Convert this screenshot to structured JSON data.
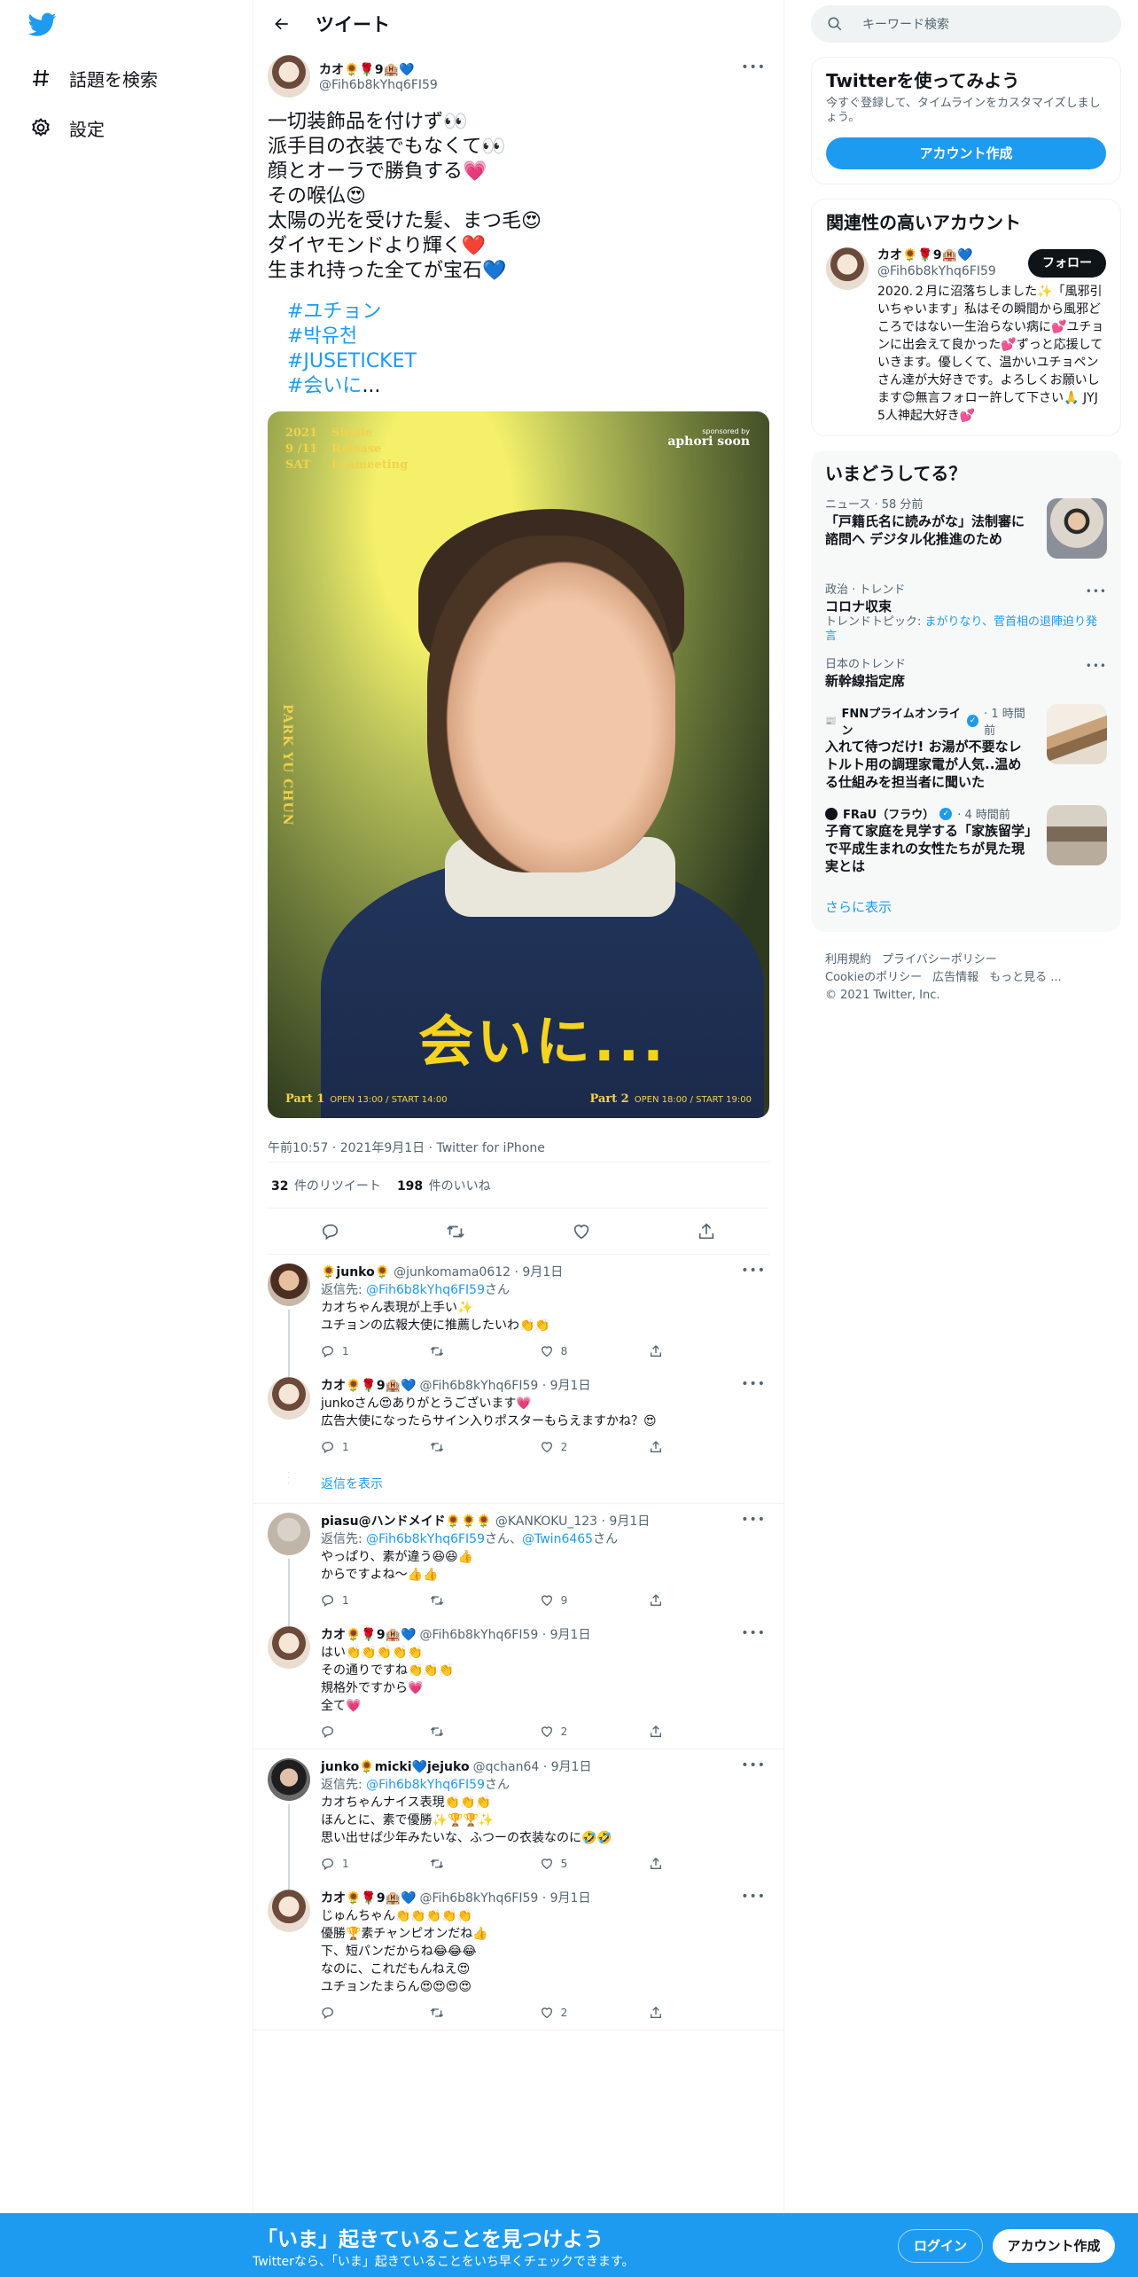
{
  "nav": {
    "explore_label": "話題を検索",
    "settings_label": "設定"
  },
  "header": {
    "title": "ツイート"
  },
  "main_tweet": {
    "display_name": "カオ🌻🌹9🏨💙",
    "handle": "@Fih6b8kYhq6FI59",
    "text": "一切装飾品を付けず👀\n派手目の衣装でもなくて👀\n顔とオーラで勝負する💗\nその喉仏😍\n太陽の光を受けた髪、まつ毛😍\nダイヤモンドより輝く❤️\n生まれ持った全てが宝石💙",
    "hashtags": [
      "#ユチョン",
      "#박유천",
      "#JUSETICKET",
      "#会いに"
    ],
    "ellipsis": "...",
    "poster": {
      "date_rows": [
        [
          "2021",
          "Single"
        ],
        [
          "9 /11",
          "Release"
        ],
        [
          "SAT",
          "Fanmeeting"
        ]
      ],
      "sponsor_small": "sponsored by",
      "sponsor_brand": "aphori soon",
      "name": "PARK YU CHUN",
      "big_title": "会いに...",
      "part1_label": "Part 1",
      "part1_time": "OPEN 13:00 / START 14:00",
      "part2_label": "Part 2",
      "part2_time": "OPEN 18:00 / START 19:00"
    },
    "timestamp": "午前10:57 · 2021年9月1日 · Twitter for iPhone",
    "retweets_count": "32",
    "retweets_label": "件のリツイート",
    "likes_count": "198",
    "likes_label": "件のいいね"
  },
  "replies": [
    {
      "name": "🌻junko🌻",
      "handle": "@junkomama0612",
      "date": "· 9月1日",
      "replying_prefix": "返信先: ",
      "replying_to": "@Fih6b8kYhq6FI59",
      "replying_suffix": "さん",
      "body": "カオちゃん表現が上手い✨\nユチョンの広報大使に推薦したいわ👏👏",
      "reply_count": "1",
      "retweet_count": "",
      "like_count": "8"
    },
    {
      "name": "カオ🌻🌹9🏨💙",
      "handle": "@Fih6b8kYhq6FI59",
      "date": "· 9月1日",
      "body": "junkoさん😍ありがとうございます💗\n広告大使になったらサイン入りポスターもらえますかね？😍",
      "reply_count": "1",
      "retweet_count": "",
      "like_count": "2"
    },
    {
      "name": "piasu@ハンドメイド🌻🌻🌻",
      "handle": "@KANKOKU_123",
      "date": "· 9月1日",
      "replying_prefix": "返信先: ",
      "replying_to": "@Fih6b8kYhq6FI59",
      "replying_mid": "さん、",
      "replying_to2": "@Twin6465",
      "replying_suffix": "さん",
      "body": "やっぱり、素が違う😆😆👍\nからですよね〜👍👍",
      "reply_count": "1",
      "retweet_count": "",
      "like_count": "9"
    },
    {
      "name": "カオ🌻🌹9🏨💙",
      "handle": "@Fih6b8kYhq6FI59",
      "date": "· 9月1日",
      "body": "はい👏👏👏👏👏\nその通りですね👏👏👏\n規格外ですから💗\n全て💗",
      "reply_count": "",
      "retweet_count": "",
      "like_count": "2"
    },
    {
      "name": "junko🌻micki💙jejuko",
      "handle": "@qchan64",
      "date": "· 9月1日",
      "replying_prefix": "返信先: ",
      "replying_to": "@Fih6b8kYhq6FI59",
      "replying_suffix": "さん",
      "body": "カオちゃんナイス表現👏👏👏\nほんとに、素で優勝✨🏆🏆✨\n思い出せば少年みたいな、ふつーの衣装なのに🤣🤣",
      "reply_count": "1",
      "retweet_count": "",
      "like_count": "5"
    },
    {
      "name": "カオ🌻🌹9🏨💙",
      "handle": "@Fih6b8kYhq6FI59",
      "date": "· 9月1日",
      "body": "じゅんちゃん👏👏👏👏👏\n優勝🏆素チャンピオンだね👍\n下、短パンだからね😂😂😂\nなのに、これだもんねえ😍\nユチョンたまらん😍😍😍😍",
      "reply_count": "",
      "retweet_count": "",
      "like_count": "2"
    }
  ],
  "show_replies_label": "返信を表示",
  "sidebar": {
    "search_placeholder": "キーワード検索",
    "signup_title": "Twitterを使ってみよう",
    "signup_desc": "今すぐ登録して、タイムラインをカスタマイズしましょう。",
    "signup_button": "アカウント作成",
    "related_title": "関連性の高いアカウント",
    "related_user": {
      "name": "カオ🌻🌹9🏨💙",
      "handle": "@Fih6b8kYhq6FI59",
      "bio": "2020.２月に沼落ちしました✨「風邪引いちゃいます」私はその瞬間から風邪どころではない一生治らない病に💕ユチョンに出会えて良かった💕ずっと応援していきます。優しくて、温かいユチョペンさん達が大好きです。よろしくお願いします😊無言フォロー許して下さい🙏 JYJ 5人神起大好き💕",
      "follow_label": "フォロー"
    },
    "trends_title": "いまどうしてる？",
    "trends": [
      {
        "category": "ニュース · 58 分前",
        "title": "「戸籍氏名に読みがな」法制審に諮問へ デジタル化推進のため"
      },
      {
        "category": "政治 · トレンド",
        "title": "コロナ収束",
        "sub_prefix": "トレンドトピック: ",
        "sub_link": "まがりなり、菅首相の退陣迫り発言"
      },
      {
        "category": "日本のトレンド",
        "title": "新幹線指定席"
      },
      {
        "source": "FNNプライムオンライン",
        "time": "· 1 時間前",
        "title": "入れて待つだけ! お湯が不要なレトルト用の調理家電が人気..温める仕組みを担当者に聞いた"
      },
      {
        "source": "FRaU（フラウ）",
        "time": "· 4 時間前",
        "title": "子育て家庭を見学する「家族留学」で平成生まれの女性たちが見た現実とは"
      }
    ],
    "show_more": "さらに表示",
    "footer_links": [
      "利用規約",
      "プライバシーポリシー",
      "Cookieのポリシー",
      "広告情報",
      "もっと見る ..."
    ],
    "copyright": "© 2021 Twitter, Inc."
  },
  "bottom_bar": {
    "title": "「いま」起きていることを見つけよう",
    "subtitle": "Twitterなら、「いま」起きていることをいち早くチェックできます。",
    "login": "ログイン",
    "signup": "アカウント作成"
  },
  "colors": {
    "accent": "#1d9bf0",
    "text": "#0f1419",
    "muted": "#536471",
    "border": "#eff3f4"
  }
}
